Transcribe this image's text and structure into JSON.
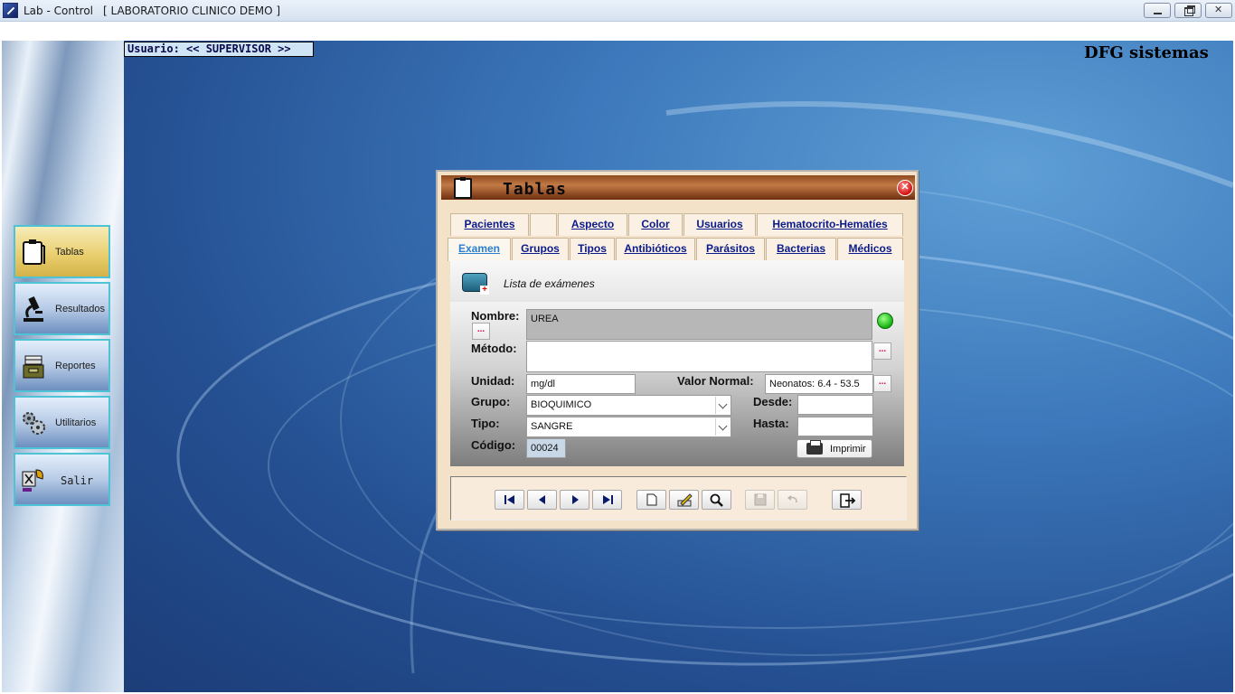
{
  "window": {
    "title": "Lab - Control",
    "subtitle": "[ LABORATORIO CLINICO DEMO ]"
  },
  "sidebar": {
    "items": [
      {
        "label": "Tablas",
        "icon": "clipboard-icon"
      },
      {
        "label": "Resultados",
        "icon": "microscope-icon"
      },
      {
        "label": "Reportes",
        "icon": "files-icon"
      },
      {
        "label": "Utilitarios",
        "icon": "gears-icon"
      },
      {
        "label": "Salir",
        "icon": "exit-icon"
      }
    ]
  },
  "desktop": {
    "user_label": "Usuario:  << SUPERVISOR >>",
    "brand": "DFG sistemas"
  },
  "dialog": {
    "title": "Tablas",
    "tabs_row1": [
      "Pacientes",
      "",
      "Aspecto",
      "Color",
      "Usuarios",
      "Hematocrito-Hematíes"
    ],
    "tabs_row2": [
      "Examen",
      "Grupos",
      "Tipos",
      "Antibióticos",
      "Parásitos",
      "Bacterias",
      "Médicos"
    ],
    "active_tab": "Examen",
    "list_label": "Lista de exámenes",
    "form": {
      "nombre_label": "Nombre:",
      "nombre_value": "UREA",
      "metodo_label": "Método:",
      "metodo_value": "",
      "unidad_label": "Unidad:",
      "unidad_value": "mg/dl",
      "valor_normal_label": "Valor Normal:",
      "valor_normal_value": "Neonatos:    6.4 - 53.5",
      "grupo_label": "Grupo:",
      "grupo_value": "BIOQUIMICO",
      "tipo_label": "Tipo:",
      "tipo_value": "SANGRE",
      "desde_label": "Desde:",
      "desde_value": "",
      "hasta_label": "Hasta:",
      "hasta_value": "",
      "codigo_label": "Código:",
      "codigo_value": "00024",
      "dots_label": "...",
      "print_label": "Imprimir"
    }
  }
}
